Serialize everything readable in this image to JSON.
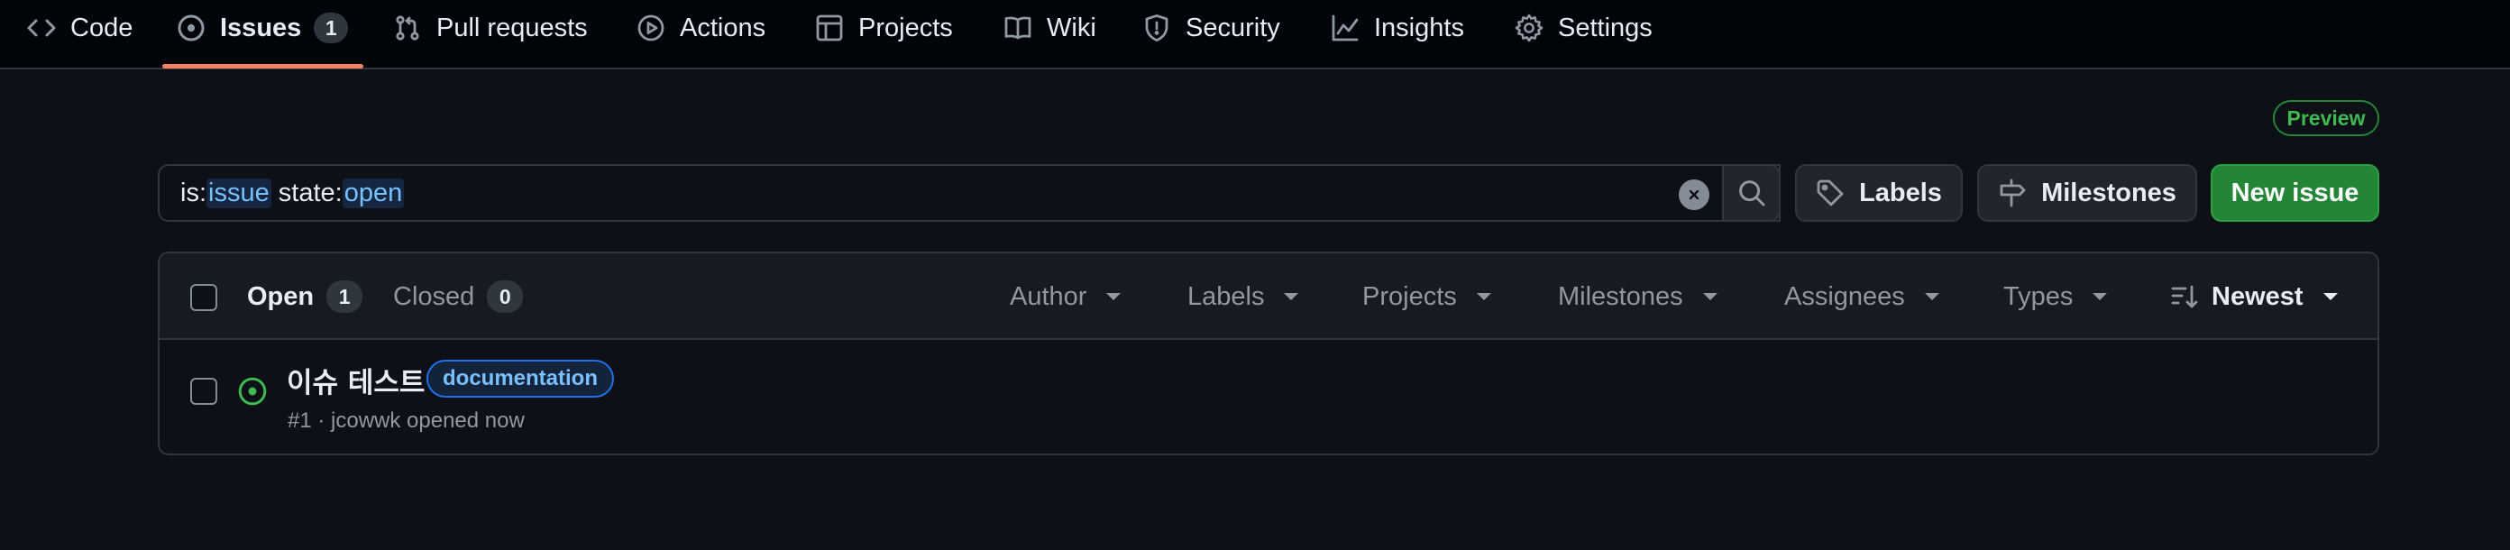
{
  "nav": {
    "code": "Code",
    "issues": "Issues",
    "issues_count": "1",
    "pull_requests": "Pull requests",
    "actions": "Actions",
    "projects": "Projects",
    "wiki": "Wiki",
    "security": "Security",
    "insights": "Insights",
    "settings": "Settings"
  },
  "preview_badge": "Preview",
  "search": {
    "key1": "is:",
    "val1": "issue",
    "key2": " state:",
    "val2": "open"
  },
  "buttons": {
    "labels": "Labels",
    "milestones": "Milestones",
    "new_issue": "New issue"
  },
  "tabs": {
    "open_label": "Open",
    "open_count": "1",
    "closed_label": "Closed",
    "closed_count": "0"
  },
  "filters": {
    "author": "Author",
    "labels": "Labels",
    "projects": "Projects",
    "milestones": "Milestones",
    "assignees": "Assignees",
    "types": "Types",
    "sort": "Newest"
  },
  "issues": [
    {
      "title": "이슈 테스트",
      "label": "documentation",
      "meta": "#1 · jcowwk opened now"
    }
  ],
  "colors": {
    "accent_underline": "#f78166",
    "open_green": "#3fb950",
    "button_green": "#238636",
    "label_blue": "#79c0ff"
  }
}
